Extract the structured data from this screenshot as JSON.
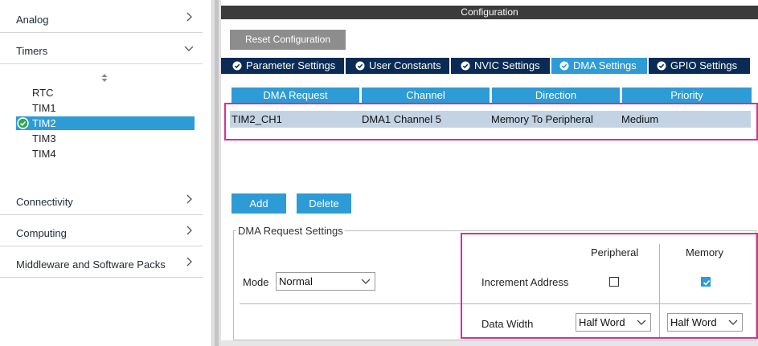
{
  "sidebar": {
    "categories": [
      {
        "label": "Analog",
        "icon": "chevron-right-icon"
      },
      {
        "label": "Timers",
        "icon": "chevron-down-icon"
      },
      {
        "label": "Connectivity",
        "icon": "chevron-right-icon"
      },
      {
        "label": "Computing",
        "icon": "chevron-right-icon"
      },
      {
        "label": "Middleware and Software Packs",
        "icon": "chevron-right-icon"
      }
    ],
    "timers": [
      "RTC",
      "TIM1",
      "TIM2",
      "TIM3",
      "TIM4"
    ],
    "selected_timer": "TIM2"
  },
  "config": {
    "title": "Configuration",
    "reset_label": "Reset Configuration",
    "tabs": [
      {
        "label": "Parameter Settings",
        "active": false
      },
      {
        "label": "User Constants",
        "active": false
      },
      {
        "label": "NVIC Settings",
        "active": false
      },
      {
        "label": "DMA Settings",
        "active": true
      },
      {
        "label": "GPIO Settings",
        "active": false
      }
    ]
  },
  "dma_table": {
    "headers": [
      "DMA Request",
      "Channel",
      "Direction",
      "Priority"
    ],
    "rows": [
      [
        "TIM2_CH1",
        "DMA1 Channel 5",
        "Memory To Peripheral",
        "Medium"
      ]
    ]
  },
  "actions": {
    "add_label": "Add",
    "delete_label": "Delete"
  },
  "dma_settings": {
    "legend": "DMA Request Settings",
    "mode_label": "Mode",
    "mode_value": "Normal",
    "peripheral_label": "Peripheral",
    "memory_label": "Memory",
    "increment_label": "Increment Address",
    "peripheral_increment": false,
    "memory_increment": true,
    "data_width_label": "Data Width",
    "peripheral_width": "Half Word",
    "memory_width": "Half Word"
  },
  "colors": {
    "accent": "#2d9bd6",
    "tab_dark": "#0a2b55",
    "highlight": "#d6318f",
    "title_bar": "#3b3b3b"
  }
}
